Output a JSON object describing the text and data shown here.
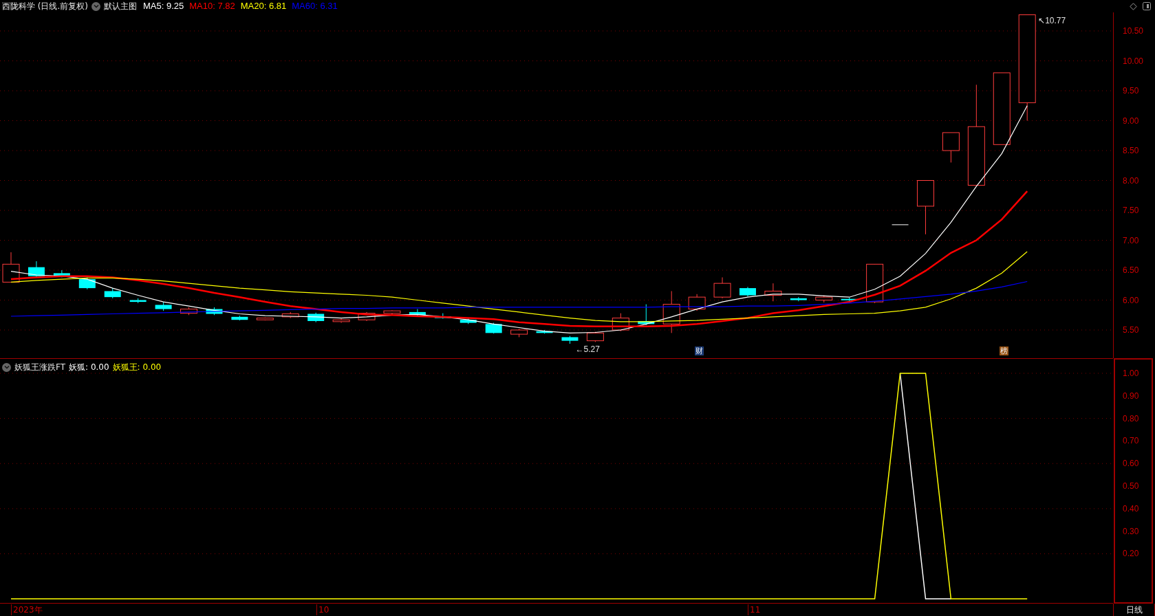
{
  "header": {
    "title": "西陇科学 (日线.前复权)",
    "template": "默认主图",
    "indicators": [
      {
        "label": "MA5: 9.25",
        "color": "#ffffff"
      },
      {
        "label": "MA10: 7.82",
        "color": "#ff0000"
      },
      {
        "label": "MA20: 6.81",
        "color": "#ffff00"
      },
      {
        "label": "MA60: 6.31",
        "color": "#0000ff"
      }
    ]
  },
  "price_chart": {
    "price_axis": [
      "10.50",
      "10.00",
      "9.50",
      "9.00",
      "8.50",
      "8.00",
      "7.50",
      "7.00",
      "6.50",
      "6.00",
      "5.50"
    ],
    "high_marker": "↖10.77",
    "low_marker": "←5.27",
    "event_badges": [
      {
        "label": "财",
        "kind": "finance"
      },
      {
        "label": "榜",
        "kind": "ranking"
      }
    ]
  },
  "indicator_panel": {
    "title": "妖狐王涨跌FT",
    "legend_values": [
      ": 0.00",
      ": 0.00"
    ],
    "chart_data": {
      "type": "line",
      "grid": true,
      "categories": [
        null,
        null,
        null,
        null,
        null,
        null,
        null,
        null,
        null,
        null,
        null,
        null,
        null,
        null,
        null,
        null,
        null,
        null,
        null,
        null,
        null,
        null,
        null,
        null,
        null,
        null,
        null,
        null,
        null,
        null,
        null,
        null,
        null,
        null,
        null,
        null,
        null,
        null,
        null,
        null,
        null
      ],
      "ylim": [
        -0.021,
        1.067
      ],
      "yticks": [
        {
          "value": 1.0,
          "label": "1.00"
        },
        {
          "value": 0.9,
          "label": "0.90"
        },
        {
          "value": 0.8,
          "label": "0.80"
        },
        {
          "value": 0.7,
          "label": "0.70"
        },
        {
          "value": 0.6,
          "label": "0.60"
        },
        {
          "value": 0.5,
          "label": "0.50"
        },
        {
          "value": 0.4,
          "label": "0.40"
        },
        {
          "value": 0.3,
          "label": "0.30"
        },
        {
          "value": 0.2,
          "label": "0.20"
        }
      ],
      "series": [
        {
          "name": "妖狐",
          "color": "#ffffff",
          "values": [
            null,
            null,
            null,
            null,
            null,
            null,
            null,
            null,
            null,
            null,
            null,
            null,
            null,
            null,
            null,
            null,
            null,
            null,
            null,
            null,
            null,
            null,
            null,
            null,
            null,
            null,
            null,
            null,
            null,
            null,
            null,
            null,
            null,
            null,
            null,
            1,
            0,
            0,
            null,
            null,
            null
          ]
        },
        {
          "name": "妖狐王",
          "color": "#ffff00",
          "values": [
            0,
            0,
            0,
            0,
            0,
            0,
            0,
            0,
            0,
            0,
            0,
            0,
            0,
            0,
            0,
            0,
            0,
            0,
            0,
            0,
            0,
            0,
            0,
            0,
            0,
            0,
            0,
            0,
            0,
            0,
            0,
            0,
            0,
            0,
            0,
            1,
            1,
            0,
            0,
            0,
            0
          ]
        }
      ]
    }
  },
  "time_axis": [
    "2023年",
    "10",
    "11"
  ],
  "period": "日线"
}
